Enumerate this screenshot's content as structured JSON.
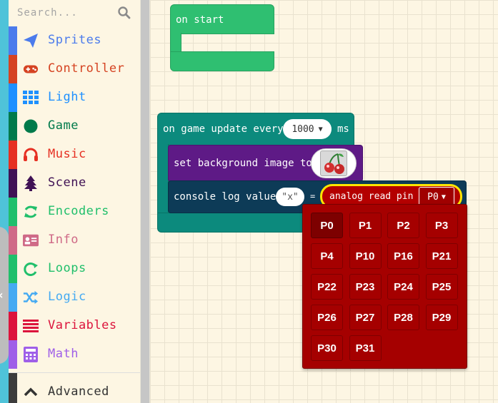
{
  "toolbox": {
    "search_placeholder": "Search...",
    "categories": [
      {
        "label": "Sprites",
        "color": "#4b7bec",
        "icon": "paper-plane-icon"
      },
      {
        "label": "Controller",
        "color": "#d54322",
        "icon": "gamepad-icon"
      },
      {
        "label": "Light",
        "color": "#1e90ff",
        "icon": "led-grid-icon"
      },
      {
        "label": "Game",
        "color": "#007a4b",
        "icon": "circle-icon"
      },
      {
        "label": "Music",
        "color": "#e63022",
        "icon": "headphones-icon"
      },
      {
        "label": "Scene",
        "color": "#401255",
        "icon": "tree-icon"
      },
      {
        "label": "Encoders",
        "color": "#20bf6b",
        "icon": "refresh-icon"
      },
      {
        "label": "Info",
        "color": "#cf6a87",
        "icon": "id-card-icon"
      },
      {
        "label": "Loops",
        "color": "#20bf6b",
        "icon": "loop-icon"
      },
      {
        "label": "Logic",
        "color": "#45aaf2",
        "icon": "shuffle-icon"
      },
      {
        "label": "Variables",
        "color": "#dc143c",
        "icon": "list-icon"
      },
      {
        "label": "Math",
        "color": "#9f5fe8",
        "icon": "calculator-icon"
      }
    ],
    "advanced_label": "Advanced"
  },
  "blocks": {
    "on_start": "on start",
    "on_game_update": "on game update every",
    "interval_value": "1000",
    "interval_unit": "ms",
    "set_background": "set background image to",
    "console_log": "console log value",
    "log_key": "\"x\"",
    "equals": "=",
    "analog_read": "analog read pin",
    "pin_value": "P0"
  },
  "pin_menu": {
    "options": [
      "P0",
      "P1",
      "P2",
      "P3",
      "P4",
      "P10",
      "P16",
      "P21",
      "P22",
      "P23",
      "P24",
      "P25",
      "P26",
      "P27",
      "P28",
      "P29",
      "P30",
      "P31"
    ],
    "selected": "P0"
  }
}
